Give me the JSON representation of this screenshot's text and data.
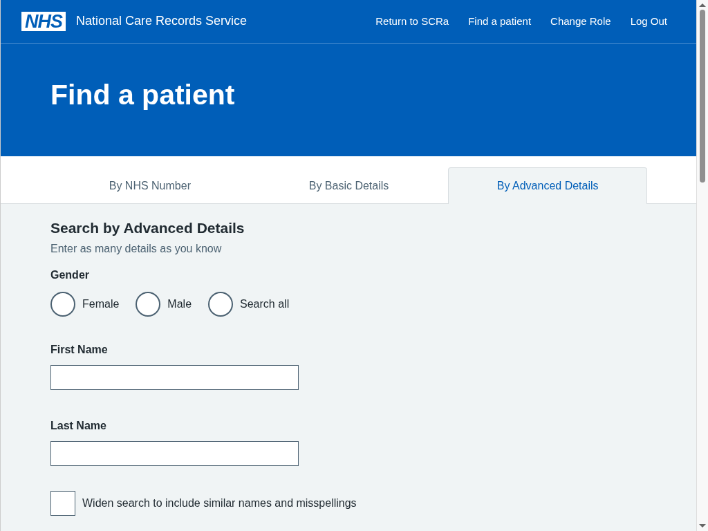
{
  "header": {
    "logo": "NHS",
    "service_name": "National Care Records Service",
    "nav": [
      "Return to SCRa",
      "Find a patient",
      "Change Role",
      "Log Out"
    ]
  },
  "page_title": "Find a patient",
  "tabs": [
    {
      "label": "By NHS Number",
      "selected": false
    },
    {
      "label": "By Basic Details",
      "selected": false
    },
    {
      "label": "By Advanced Details",
      "selected": true
    }
  ],
  "form": {
    "heading": "Search by Advanced Details",
    "hint": "Enter as many details as you know",
    "gender": {
      "label": "Gender",
      "options": [
        {
          "label": "Female",
          "selected": false
        },
        {
          "label": "Male",
          "selected": false
        },
        {
          "label": "Search all",
          "selected": false
        }
      ]
    },
    "fields": [
      {
        "label": "First Name"
      },
      {
        "label": "Last Name"
      }
    ],
    "widen_search": {
      "label": "Widen search to include similar names and misspellings",
      "checked": false
    }
  }
}
